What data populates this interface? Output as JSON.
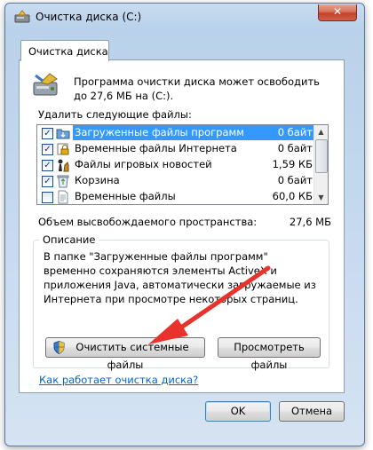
{
  "window": {
    "title": "Очистка диска  (C:)",
    "close_label": "✕"
  },
  "tab": {
    "label": "Очистка диска"
  },
  "header": {
    "text": "Программа очистки диска может освободить до 27,6 МБ на  (C:)."
  },
  "files_label": "Удалить следующие файлы:",
  "files": [
    {
      "name": "Загруженные файлы программ",
      "size": "0 байт",
      "checked": true,
      "selected": true,
      "icon": "folder-download-icon"
    },
    {
      "name": "Временные файлы Интернета",
      "size": "0 байт",
      "checked": true,
      "selected": false,
      "icon": "lock-icon"
    },
    {
      "name": "Файлы игровых новостей",
      "size": "1,59 КБ",
      "checked": true,
      "selected": false,
      "icon": "chess-pieces-icon"
    },
    {
      "name": "Корзина",
      "size": "0 байт",
      "checked": true,
      "selected": false,
      "icon": "recycle-bin-icon"
    },
    {
      "name": "Временные файлы",
      "size": "60,0 КБ",
      "checked": false,
      "selected": false,
      "icon": "document-icon"
    }
  ],
  "space": {
    "label": "Объем высвобождаемого пространства:",
    "value": "27,6 МБ"
  },
  "description": {
    "title": "Описание",
    "text": "В папке \"Загруженные файлы программ\" временно сохраняются элементы ActiveX и приложения Java, автоматически загружаемые из Интернета при просмотре некоторых страниц."
  },
  "buttons": {
    "clean_system": "Очистить системные файлы",
    "view_files": "Просмотреть файлы",
    "ok": "OK",
    "cancel": "Отмена"
  },
  "link": {
    "text": "Как работает очистка диска?"
  },
  "colors": {
    "selection": "#3399ff",
    "link": "#0066cc",
    "arrow": "#e8322b"
  }
}
